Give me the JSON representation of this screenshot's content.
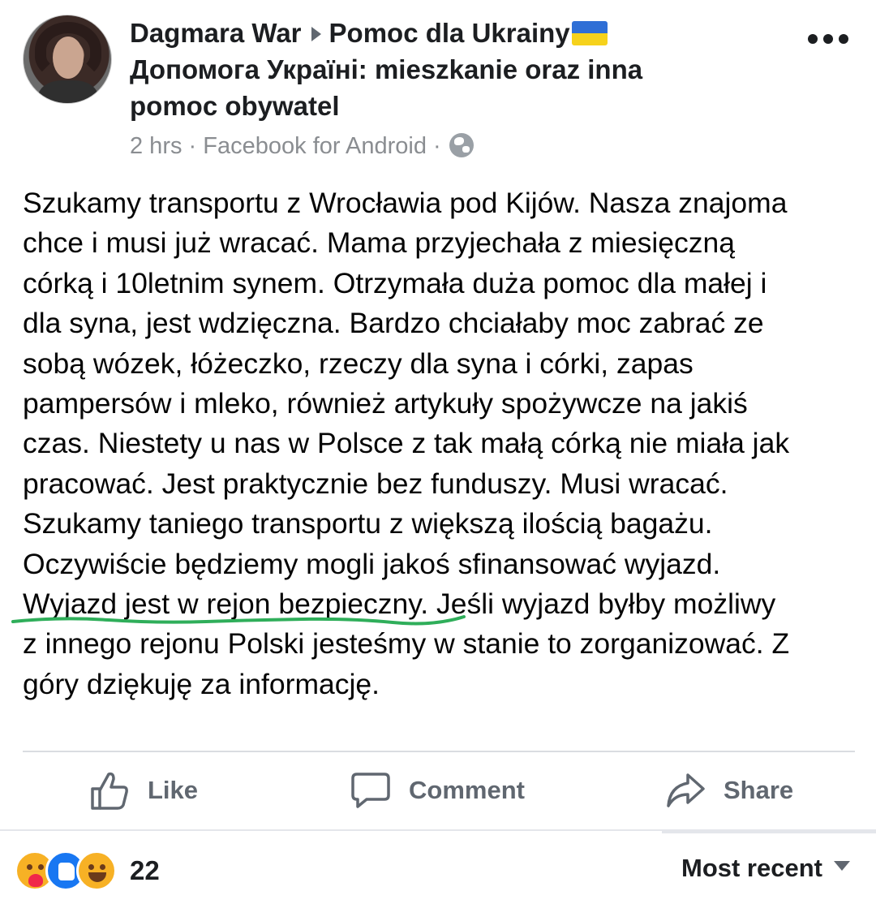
{
  "post": {
    "author": "Dagmara War",
    "group_line1": "Pomoc dla Ukrainy",
    "group_line2": "Допомога Україні: mieszkanie oraz inna",
    "group_line3": "pomoc obywatel",
    "time": "2 hrs",
    "source": "Facebook for Android",
    "separator": "·",
    "privacy_icon": "globe-icon",
    "more_icon": "more-options-icon",
    "body_lines": [
      "Szukamy transportu z Wrocławia pod Kijów. Nasza znajoma",
      "chce i musi już wracać. Mama przyjechała z miesięczną",
      "córką i 10letnim synem. Otrzymała duża pomoc dla małej i",
      "dla syna, jest wdzięczna. Bardzo chciałaby moc zabrać ze",
      "sobą wózek, łóżeczko, rzeczy dla syna i córki, zapas",
      "pampersów i mleko, również artykuły spożywcze na jakiś",
      "czas. Niestety u nas w Polsce z tak małą córką nie miała jak",
      "pracować. Jest praktycznie bez funduszy. Musi wracać.",
      "Szukamy taniego transportu z większą ilością bagażu.",
      "Oczywiście będziemy mogli jakoś sfinansować wyjazd.",
      "Wyjazd jest w rejon bezpieczny. Jeśli wyjazd byłby możliwy",
      "z innego rejonu Polski jesteśmy w stanie to zorganizować. Z",
      "góry dziękuję za informację."
    ],
    "highlight_color": "#2fae5a"
  },
  "actions": {
    "like": "Like",
    "comment": "Comment",
    "share": "Share"
  },
  "footer": {
    "reaction_icons": [
      "care-reaction-icon",
      "like-reaction-icon",
      "haha-reaction-icon"
    ],
    "reaction_count": "22",
    "sort_label": "Most recent"
  },
  "colors": {
    "text": "#050505",
    "muted": "#8a8d91",
    "action": "#606770",
    "flag_blue": "#2f6fd6",
    "flag_yellow": "#f6d21c"
  }
}
